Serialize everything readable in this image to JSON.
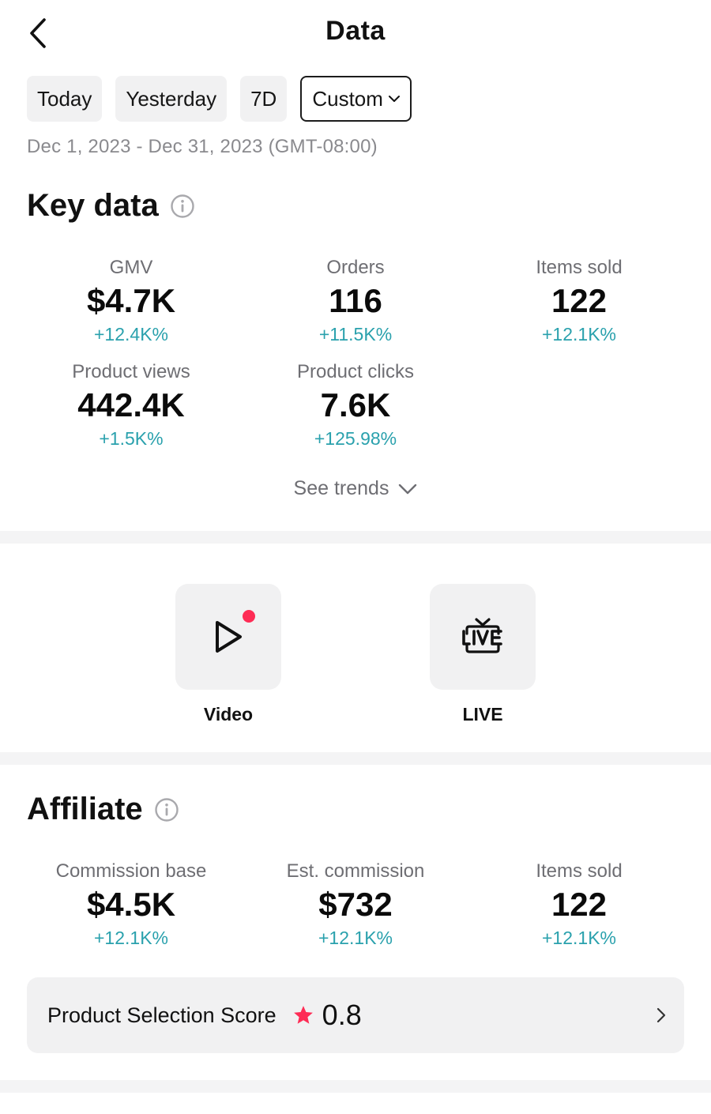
{
  "header": {
    "title": "Data",
    "back_icon": "chevron-left-icon"
  },
  "filters": {
    "today": "Today",
    "yesterday": "Yesterday",
    "seven_day": "7D",
    "custom": "Custom",
    "selected": "Custom"
  },
  "date_range": "Dec 1, 2023 - Dec 31, 2023 (GMT-08:00)",
  "key_data": {
    "title": "Key data",
    "metrics": [
      {
        "label": "GMV",
        "value": "$4.7K",
        "change": "+12.4K%"
      },
      {
        "label": "Orders",
        "value": "116",
        "change": "+11.5K%"
      },
      {
        "label": "Items sold",
        "value": "122",
        "change": "+12.1K%"
      },
      {
        "label": "Product views",
        "value": "442.4K",
        "change": "+1.5K%"
      },
      {
        "label": "Product clicks",
        "value": "7.6K",
        "change": "+125.98%"
      }
    ],
    "see_trends": "See trends"
  },
  "content_types": [
    {
      "label": "Video",
      "icon": "play-icon",
      "has_dot": true
    },
    {
      "label": "LIVE",
      "icon": "live-tv-icon",
      "has_dot": false
    }
  ],
  "affiliate": {
    "title": "Affiliate",
    "metrics": [
      {
        "label": "Commission base",
        "value": "$4.5K",
        "change": "+12.1K%"
      },
      {
        "label": "Est. commission",
        "value": "$732",
        "change": "+12.1K%"
      },
      {
        "label": "Items sold",
        "value": "122",
        "change": "+12.1K%"
      }
    ],
    "score": {
      "label": "Product Selection Score",
      "value": "0.8"
    }
  },
  "colors": {
    "positive_change": "#2aa1ad",
    "accent_red": "#fe2c55",
    "chip_bg": "#f1f1f2"
  }
}
